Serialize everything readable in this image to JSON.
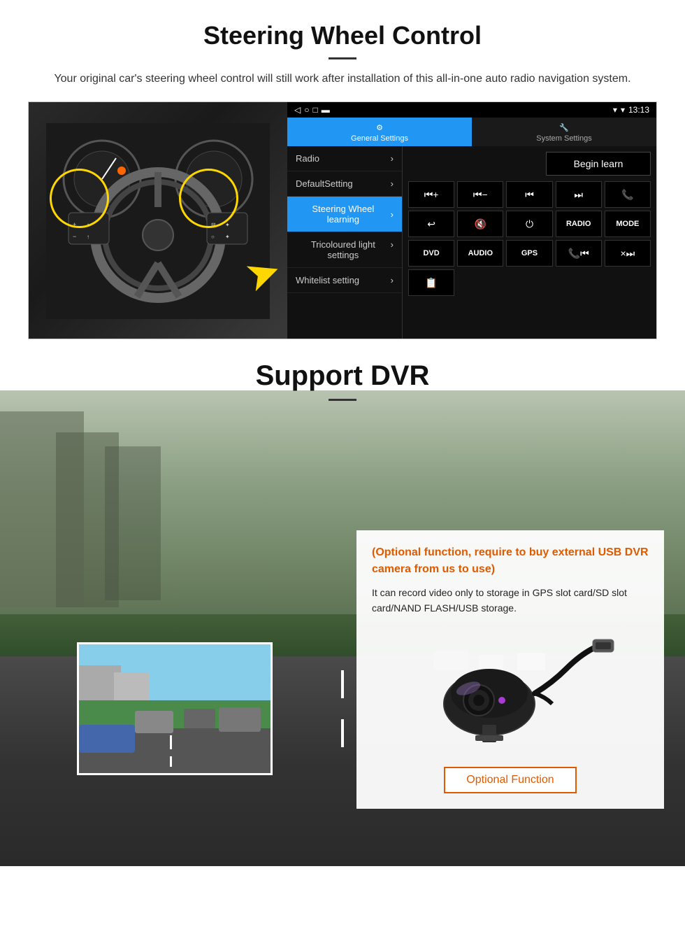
{
  "steering": {
    "title": "Steering Wheel Control",
    "subtitle": "Your original car's steering wheel control will still work after installation of this all-in-one auto radio navigation system.",
    "statusbar": {
      "time": "13:13",
      "icons": "▼ ▾"
    },
    "tabs": {
      "general": "General Settings",
      "system": "System Settings"
    },
    "menu": {
      "items": [
        {
          "label": "Radio",
          "active": false
        },
        {
          "label": "DefaultSetting",
          "active": false
        },
        {
          "label": "Steering Wheel learning",
          "active": true
        },
        {
          "label": "Tricoloured light settings",
          "active": false
        },
        {
          "label": "Whitelist setting",
          "active": false
        }
      ]
    },
    "begin_learn": "Begin learn",
    "controls": [
      "⏮+",
      "⏮−",
      "⏮|",
      "|⏭",
      "📞",
      "↩",
      "🔇×",
      "⏻",
      "RADIO",
      "MODE",
      "DVD",
      "AUDIO",
      "GPS",
      "📞|⏮",
      "×|⏭",
      "📋"
    ]
  },
  "dvr": {
    "title": "Support DVR",
    "optional_notice": "(Optional function, require to buy external USB DVR camera from us to use)",
    "description": "It can record video only to storage in GPS slot card/SD slot card/NAND FLASH/USB storage.",
    "optional_function_btn": "Optional Function"
  }
}
